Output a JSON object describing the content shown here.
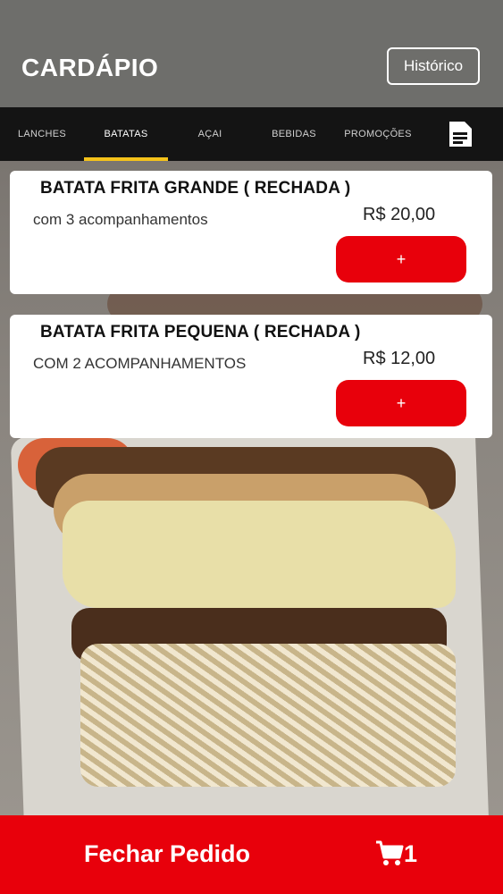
{
  "header": {
    "title": "CARDÁPIO",
    "history_label": "Histórico"
  },
  "tabs": [
    {
      "label": "LANCHES"
    },
    {
      "label": "BATATAS",
      "active": true
    },
    {
      "label": "AÇAI"
    },
    {
      "label": "BEBIDAS"
    },
    {
      "label": "PROMOÇÕES"
    }
  ],
  "tab_extra_icon": "document-icon",
  "products": [
    {
      "name": "BATATA FRITA GRANDE ( RECHADA )",
      "description": "com 3 acompanhamentos",
      "price": "R$ 20,00",
      "add_label": "+"
    },
    {
      "name": "BATATA FRITA PEQUENA ( RECHADA )",
      "description": "COM 2 ACOMPANHAMENTOS",
      "price": "R$ 12,00",
      "add_label": "+"
    }
  ],
  "footer": {
    "close_order_label": "Fechar Pedido",
    "cart_icon": "cart-icon",
    "cart_count": "1"
  },
  "colors": {
    "header_bg": "#6e6e6b",
    "tabs_bg": "#141414",
    "tab_indicator": "#f4c21a",
    "accent_red": "#e8000b"
  }
}
